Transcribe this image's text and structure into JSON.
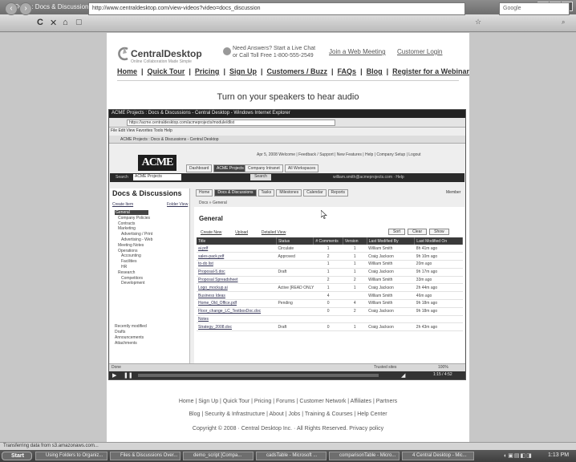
{
  "browser": {
    "window_title": "Demo: Docs & Discussions Overview - CentralDesktop - Windows Internet Explorer",
    "url": "http://www.centraldesktop.com/view-videos?video=docs_discussion",
    "search_placeholder": "Google",
    "status": "Transferring data from s3.amazonaws.com...",
    "window_buttons": [
      "_",
      "□",
      "✕"
    ]
  },
  "site": {
    "logo": "CentralDesktop",
    "logo_tagline": "Online Collaboration Made Simple",
    "promo_line1": "Need Answers? Start a Live Chat",
    "promo_line2": "or Call Toll Free 1-800-555-2549",
    "webmeeting": "Join a Web Meeting",
    "login": "Customer Login",
    "nav": [
      "Home",
      "Quick Tour",
      "Pricing",
      "Sign Up",
      "Customers / Buzz",
      "FAQs",
      "Blog",
      "Register for a Webinar"
    ],
    "audio_notice": "Turn on your speakers to hear audio"
  },
  "video": {
    "title": "ACME Projects : Docs & Discussions - Central Desktop - Windows Internet Explorer",
    "url": "https://acme.centraldesktop.com/acmeprojects/module/dlist",
    "menu": "File  Edit  View  Favorites  Tools  Help",
    "tab_title": "ACME Projects : Docs & Discussions - Central Desktop",
    "logo": "ACME",
    "toplinks": "Apr 5, 2008  Welcome  |  Feedback / Support  |  New Features  |  Help  |  Company Setup  |  Logout",
    "top_tabs": [
      "Dashboard",
      "ACME Projects",
      "Company Intranet",
      "All Workspaces"
    ],
    "search_label": "Search",
    "search_select": "ACME Projects",
    "search_button": "Search",
    "user_info": "william.smith@acmeprojects.com  ·  Help",
    "sidebar": {
      "heading": "Docs & Discussions",
      "create": "Create Item",
      "folder_view": "Folder View",
      "tree": [
        {
          "label": "General",
          "level": 0,
          "selected": true
        },
        {
          "label": "Company Policies",
          "level": 1
        },
        {
          "label": "Contracts",
          "level": 1
        },
        {
          "label": "Marketing",
          "level": 1
        },
        {
          "label": "Advertising / Print",
          "level": 2
        },
        {
          "label": "Advertising - Web",
          "level": 2
        },
        {
          "label": "Meeting Notes",
          "level": 1
        },
        {
          "label": "Operations",
          "level": 1
        },
        {
          "label": "Accounting",
          "level": 2
        },
        {
          "label": "Facilities",
          "level": 2
        },
        {
          "label": "HR",
          "level": 2
        },
        {
          "label": "Research",
          "level": 1
        },
        {
          "label": "Competitors",
          "level": 2
        },
        {
          "label": "Development",
          "level": 2
        }
      ],
      "bottom": [
        "Recently modified",
        "Drafts",
        "Announcements",
        "Attachments"
      ]
    },
    "content_tabs": [
      {
        "label": "Home",
        "selected": false
      },
      {
        "label": "Docs & Discussions",
        "selected": true
      },
      {
        "label": "Tasks",
        "selected": false
      },
      {
        "label": "Milestones",
        "selected": false
      },
      {
        "label": "Calendar",
        "selected": false
      },
      {
        "label": "Reports",
        "selected": false
      }
    ],
    "member_link": "Member",
    "breadcrumb": "Docs » General",
    "folder_title": "General",
    "toolbar": [
      "Create New",
      "Upload",
      "Detailed View"
    ],
    "right_buttons": [
      "Sort",
      "Clear",
      "Show"
    ],
    "table": {
      "headers": [
        "Title",
        "Status",
        "# Comments",
        "Version",
        "Last Modified By",
        "Last Modified On"
      ],
      "rows": [
        [
          "ai.pdf",
          "Circulate",
          "1",
          "1",
          "William Smith",
          "8h 41m ago"
        ],
        [
          "sales-pack.pdf",
          "Approved",
          "2",
          "1",
          "Craig Jackson",
          "9h 10m ago"
        ],
        [
          "to-do list",
          "",
          "1",
          "1",
          "William Smith",
          "20m ago"
        ],
        [
          "Proposal-5.doc",
          "Draft",
          "1",
          "1",
          "Craig Jackson",
          "9h 17m ago"
        ],
        [
          "Proposal Spreadsheet",
          "",
          "2",
          "2",
          "William Smith",
          "33m ago"
        ],
        [
          "Logo_mockup.ai",
          "Active [READ ONLY]",
          "1",
          "1",
          "Craig Jackson",
          "2h 44m ago"
        ],
        [
          "Business Ideas",
          "",
          "4",
          "",
          "William Smith",
          "46m ago"
        ],
        [
          "Home_Old_Office.pdf",
          "Pending",
          "0",
          "4",
          "William Smith",
          "9h 18m ago"
        ],
        [
          "Floor_change_LC_TextboxDoc.doc",
          "",
          "0",
          "2",
          "Craig Jackson",
          "9h 18m ago"
        ],
        [
          "Notes",
          "",
          "",
          "",
          "",
          ""
        ],
        [
          "Strategy_2008.doc",
          "Draft",
          "0",
          "1",
          "Craig Jackson",
          "2h 43m ago"
        ]
      ]
    },
    "status_left": "Done",
    "status_right": "Trusted sites",
    "zoom": "100%",
    "time": "1:15 / 4:52"
  },
  "footer": {
    "line1": "Home | Sign Up | Quick Tour | Pricing | Forums | Customer Network | Affiliates | Partners",
    "line2": "Blog | Security & Infrastructure | About | Jobs | Training & Courses | Help Center",
    "line3": "Copyright © 2008 · Central Desktop Inc. · All Rights Reserved. Privacy policy"
  },
  "taskbar": {
    "start": "Start",
    "tasks": [
      "Using Folders to Organiz...",
      "Files & Discussions Over...",
      "demo_script [Compa...",
      "cadsTable - Microsoft ...",
      "comparisonTable - Micro...",
      "4 Central Desktop - Mic..."
    ],
    "clock": "1:13 PM"
  }
}
